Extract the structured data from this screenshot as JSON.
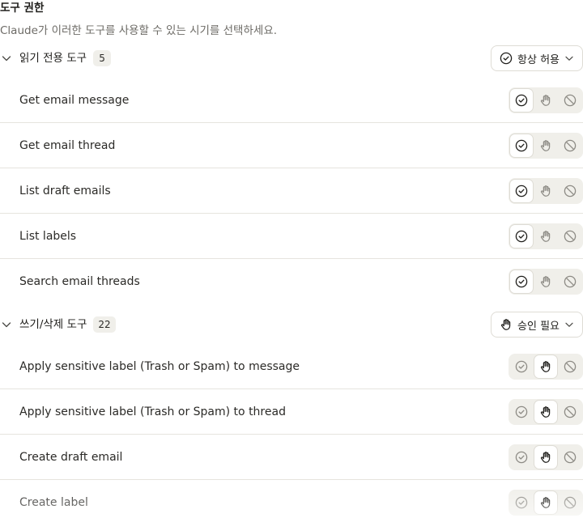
{
  "header": {
    "title": "도구 권한",
    "subtitle": "Claude가 이러한 도구를 사용할 수 있는 시기를 선택하세요."
  },
  "groups": [
    {
      "name": "읽기 전용 도구",
      "count": "5",
      "policy_label": "항상 허용",
      "policy_icon": "check-circle-icon",
      "tools": [
        {
          "name": "Get email message",
          "selected": "always-allow"
        },
        {
          "name": "Get email thread",
          "selected": "always-allow"
        },
        {
          "name": "List draft emails",
          "selected": "always-allow"
        },
        {
          "name": "List labels",
          "selected": "always-allow"
        },
        {
          "name": "Search email threads",
          "selected": "always-allow"
        }
      ]
    },
    {
      "name": "쓰기/삭제 도구",
      "count": "22",
      "policy_label": "승인 필요",
      "policy_icon": "hand-icon",
      "tools": [
        {
          "name": "Apply sensitive label (Trash or Spam) to message",
          "selected": "needs-approval"
        },
        {
          "name": "Apply sensitive label (Trash or Spam) to thread",
          "selected": "needs-approval"
        },
        {
          "name": "Create draft email",
          "selected": "needs-approval"
        },
        {
          "name": "Create label",
          "selected": "needs-approval"
        }
      ]
    }
  ],
  "permission_options": [
    {
      "key": "always-allow",
      "icon": "check-circle-icon"
    },
    {
      "key": "needs-approval",
      "icon": "hand-icon"
    },
    {
      "key": "block",
      "icon": "block-icon"
    }
  ],
  "colors": {
    "icon_active": "#1f1e1b",
    "icon_inactive": "#8d8b85",
    "segment_bg": "#f0efea",
    "divider": "#e6e4de",
    "subtitle": "#6d6b66"
  }
}
